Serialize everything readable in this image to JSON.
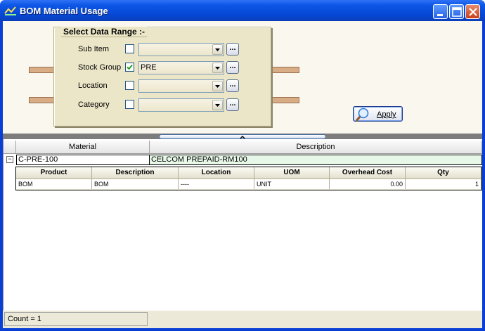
{
  "window": {
    "title": "BOM Material Usage"
  },
  "filters": {
    "legend": "Select Data Range :-",
    "rows": [
      {
        "label": "Sub Item",
        "checked": false,
        "value": "",
        "browse": "..."
      },
      {
        "label": "Stock Group",
        "checked": true,
        "value": "PRE",
        "browse": "..."
      },
      {
        "label": "Location",
        "checked": false,
        "value": "",
        "browse": "..."
      },
      {
        "label": "Category",
        "checked": false,
        "value": "",
        "browse": "..."
      }
    ]
  },
  "apply_button": {
    "label": "Apply"
  },
  "grid": {
    "columns": [
      "Material",
      "Description"
    ],
    "rows": [
      {
        "material": "C-PRE-100",
        "description": "CELCOM PREPAID-RM100",
        "expander": "−",
        "child": {
          "columns": [
            "Product",
            "Description",
            "Location",
            "UOM",
            "Overhead Cost",
            "Qty"
          ],
          "rows": [
            [
              "BOM",
              "BOM",
              "----",
              "UNIT",
              "0.00",
              "1"
            ]
          ]
        }
      }
    ]
  },
  "status": {
    "count": "Count = 1"
  },
  "colors": {
    "titlebar": "#0d56e6",
    "panel": "#faf7ee",
    "group": "#ebe6c8",
    "master_row": "#e8f8e8"
  }
}
